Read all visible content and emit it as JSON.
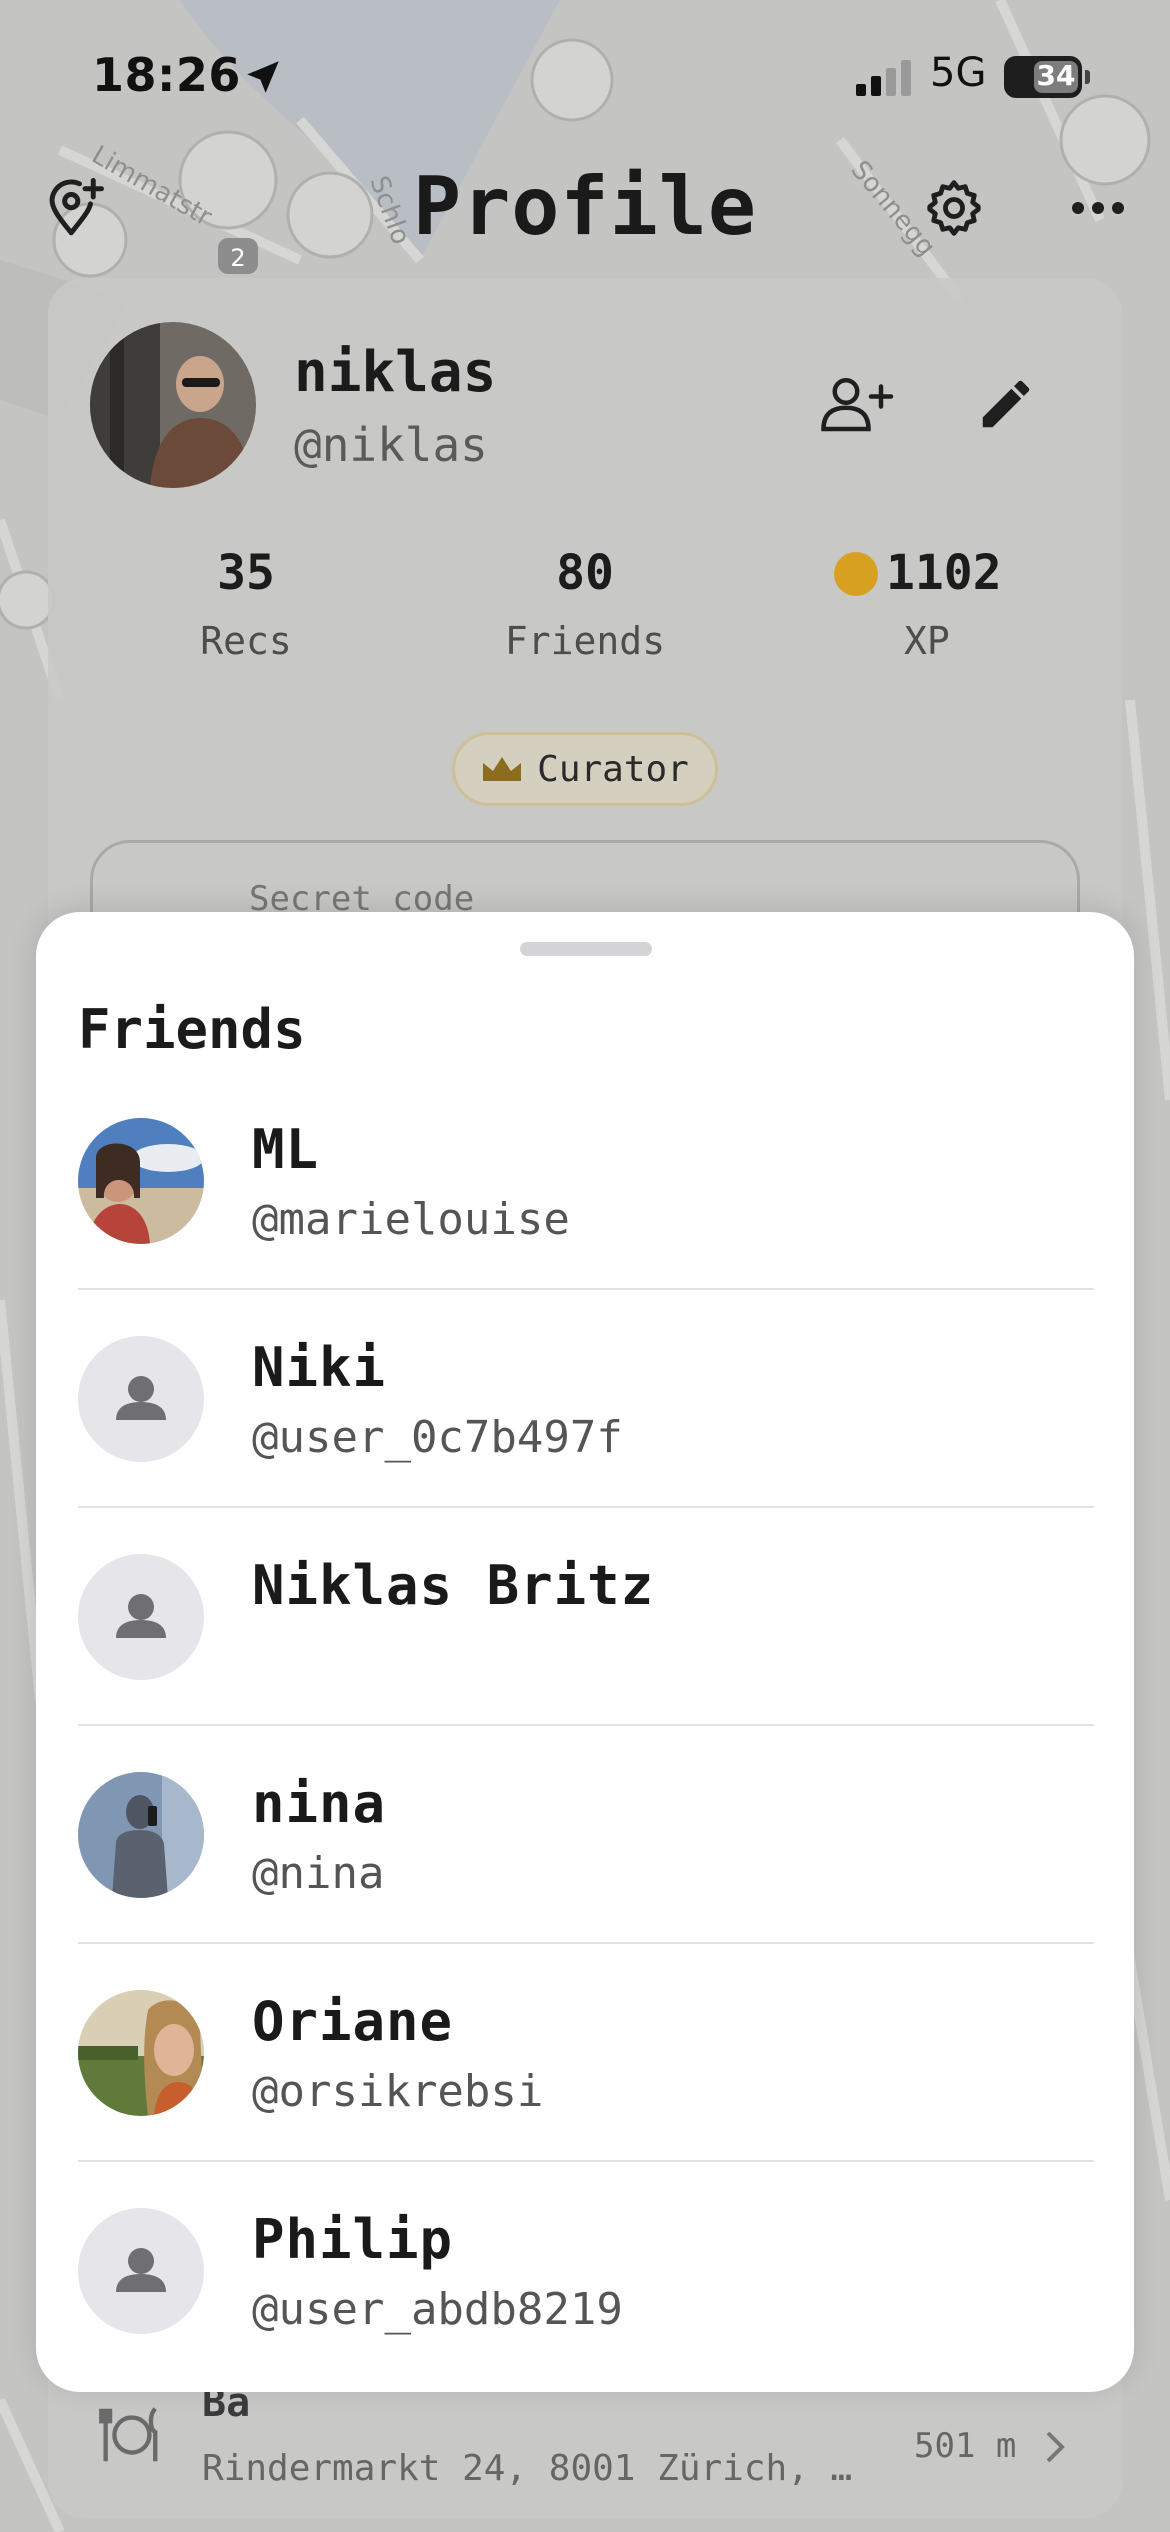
{
  "status_bar": {
    "time": "18:26",
    "network": "5G",
    "battery": "34"
  },
  "header": {
    "title": "Profile"
  },
  "profile": {
    "name": "niklas",
    "handle": "@niklas",
    "stats": [
      {
        "value": "35",
        "label": "Recs"
      },
      {
        "value": "80",
        "label": "Friends"
      },
      {
        "value": "1102",
        "label": "XP"
      }
    ],
    "badge": "Curator",
    "secret_code_label": "Secret code"
  },
  "map_labels": {
    "street_1": "Limmatstr",
    "street_2": "Sonnegg",
    "street_3": "Schlo",
    "cluster_count": "2"
  },
  "background_place": {
    "title": "Ba",
    "address": "Rindermarkt 24, 8001 Zürich, …",
    "distance": "501 m"
  },
  "friends_sheet": {
    "title": "Friends",
    "friends": [
      {
        "name": "ML",
        "handle": "@marielouise",
        "avatar": "photo-beach"
      },
      {
        "name": "Niki",
        "handle": "@user_0c7b497f",
        "avatar": "person-placeholder-icon"
      },
      {
        "name": "Niklas Britz",
        "handle": "",
        "avatar": "person-placeholder-icon"
      },
      {
        "name": "nina",
        "handle": "@nina",
        "avatar": "photo-mirror"
      },
      {
        "name": "Oriane",
        "handle": "@orsikrebsi",
        "avatar": "photo-field"
      },
      {
        "name": "Philip",
        "handle": "@user_abdb8219",
        "avatar": "person-placeholder-icon"
      }
    ]
  },
  "colors": {
    "accent_gold": "#d8a021",
    "sheet_bg": "#ffffff",
    "placeholder_bg": "#e5e5ea",
    "placeholder_fg": "#6e6e73"
  }
}
